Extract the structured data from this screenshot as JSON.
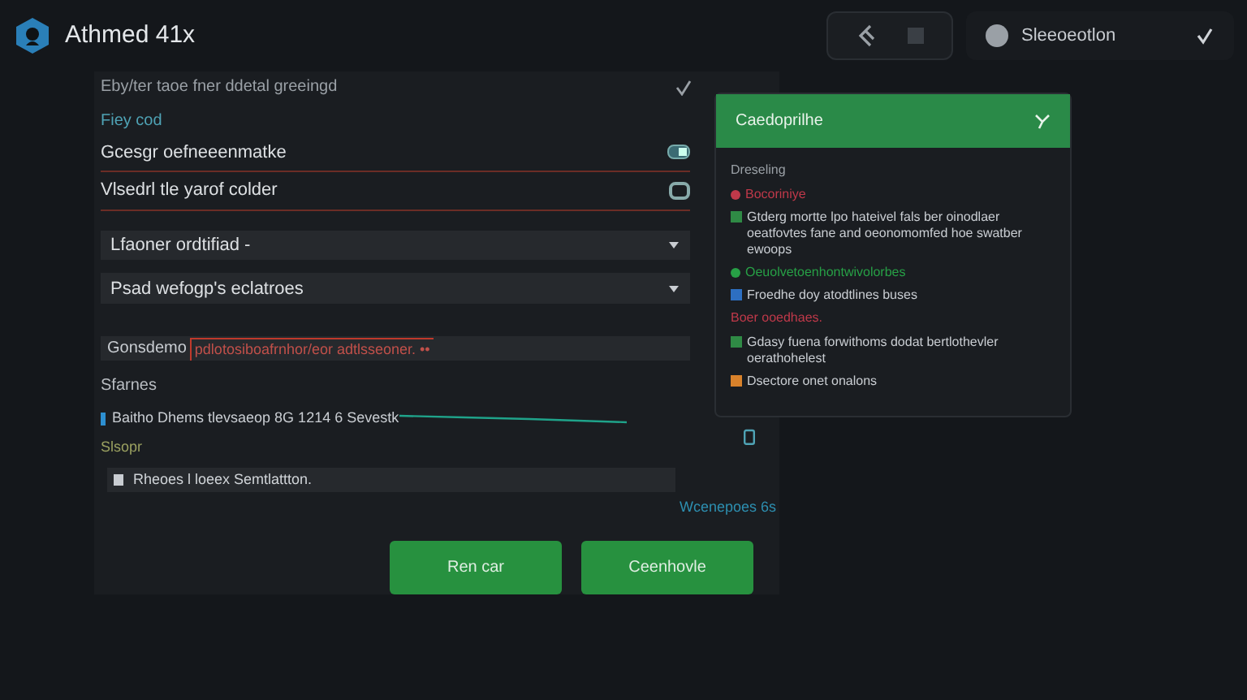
{
  "app": {
    "title": "Athmed 41x"
  },
  "header": {
    "user_label": "Sleeoeotlon"
  },
  "form": {
    "intro": "Eby/ter taoe fner ddetal greeingd",
    "section_label": "Fiey cod",
    "fields": [
      {
        "value": "Gcesgr oefneeenmatke",
        "kind": "toggle"
      },
      {
        "value": "Vlsedrl tle yarof colder",
        "kind": "checkbox"
      }
    ],
    "dropdowns": [
      {
        "value": "Lfaoner ordtifiad -"
      },
      {
        "value": "Psad wefogp's eclatroes"
      }
    ],
    "error_row": {
      "label": "Gonsdemo",
      "message": "pdlotosiboafrnhor/eor adtlsseoner. ••"
    },
    "status_label": "Sfarnes",
    "status_line": "Baitho Dhems tlevsaeop 8G 1214 6 Sevestk",
    "size_label": "Slsopr",
    "note_field": {
      "value": "Rheoes l loeex Semtlattton."
    },
    "link": "Wcenepoes 6s",
    "buttons": [
      "Ren car",
      "Ceenhovle"
    ]
  },
  "panel": {
    "title": "Caedoprilhe",
    "subtitle": "Dreseling",
    "items": [
      {
        "kind": "dot",
        "color": "#c0394a",
        "text": "Bocoriniye"
      },
      {
        "kind": "square",
        "color": "#2f8a45",
        "text": "Gtderg mortte lpo hateivel fals ber oinodlaer oeatfovtes fane and oeonomomfed hoe swatber ewoops"
      },
      {
        "kind": "dot",
        "color": "#27a046",
        "text": "Oeuolvetoenhontwivolorbes"
      },
      {
        "kind": "square",
        "color": "#2d6fc2",
        "text": "Froedhe doy atodtlines buses",
        "note": "Boer ooedhaes."
      },
      {
        "kind": "square",
        "color": "#2f8a45",
        "text": "Gdasy fuena forwithoms dodat bertlothevler oerathohelest"
      },
      {
        "kind": "square",
        "color": "#d9822b",
        "text": "Dsectore onet onalons"
      }
    ]
  }
}
